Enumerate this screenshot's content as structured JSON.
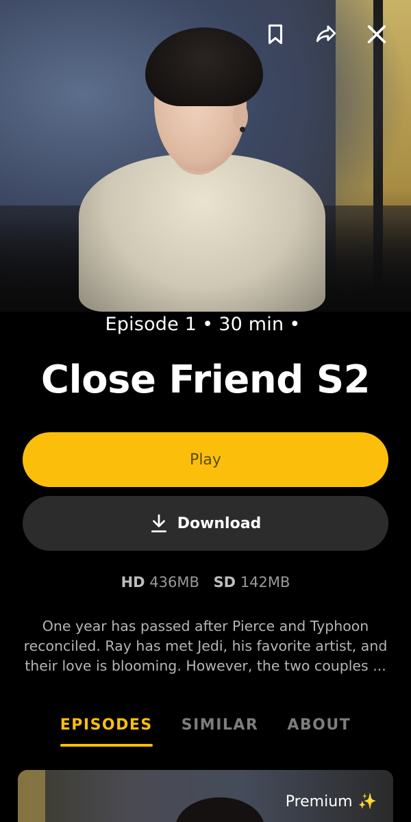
{
  "header": {
    "icons": [
      "bookmark-icon",
      "share-icon",
      "close-icon"
    ]
  },
  "episode": {
    "meta_episode": "Episode 1",
    "meta_duration": "30 min",
    "title": "Close Friend S2"
  },
  "actions": {
    "play_label": "Play",
    "download_label": "Download"
  },
  "sizes": {
    "hd_label": "HD",
    "hd_value": "436MB",
    "sd_label": "SD",
    "sd_value": "142MB"
  },
  "description": "One year has passed after Pierce and Typhoon reconciled. Ray has met Jedi, his favorite artist, and their love is blooming. However, the two couples ...",
  "tabs": [
    {
      "label": "EPISODES",
      "active": true
    },
    {
      "label": "SIMILAR",
      "active": false
    },
    {
      "label": "ABOUT",
      "active": false
    }
  ],
  "episode_card": {
    "badge": "Premium"
  },
  "colors": {
    "accent": "#fbbf0b",
    "background": "#000000",
    "secondary_button": "#2c2c2c"
  }
}
